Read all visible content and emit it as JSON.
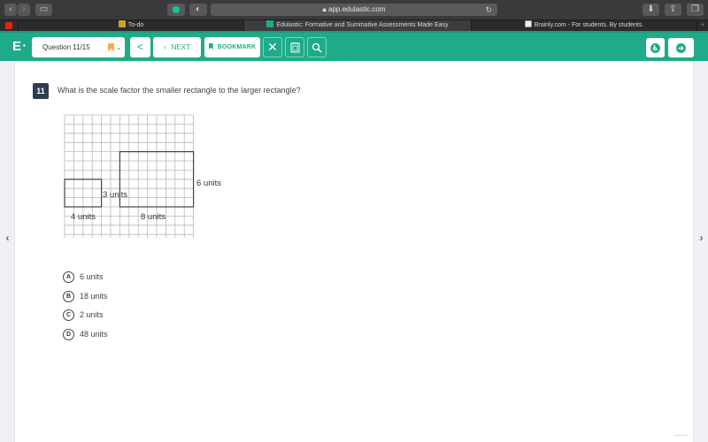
{
  "browser": {
    "url": "app.edulastic.com",
    "tabs": [
      {
        "title": "To-do",
        "icon": "classroom-icon",
        "active": false
      },
      {
        "title": "Edulastic: Formative and Summative Assessments Made Easy",
        "icon": "edulastic-icon",
        "active": true
      },
      {
        "title": "Brainly.com - For students. By students.",
        "icon": "brainly-icon",
        "active": false
      }
    ],
    "new_tab": "+"
  },
  "header": {
    "logo": "E",
    "question_selector": "Question 11/15",
    "prev_label": "<",
    "next_label": "NEXT",
    "bookmark_label": "BOOKMARK",
    "accent_color": "#1fab89"
  },
  "question": {
    "number": "11",
    "text": "What is the scale factor the smaller rectangle to the larger rectangle?",
    "figure": {
      "grid_columns": 14,
      "grid_rows": 14,
      "small_rect": {
        "width_units": 4,
        "height_units": 3,
        "width_label": "4 units",
        "height_label": "3 units"
      },
      "large_rect": {
        "width_units": 8,
        "height_units": 6,
        "width_label": "8 units",
        "height_label": "6 units"
      }
    },
    "options": [
      {
        "letter": "A",
        "label": "6 units"
      },
      {
        "letter": "B",
        "label": "18 units"
      },
      {
        "letter": "C",
        "label": "2 units"
      },
      {
        "letter": "D",
        "label": "48 units"
      }
    ]
  },
  "nav": {
    "prev_arrow": "‹",
    "next_arrow": "›"
  }
}
